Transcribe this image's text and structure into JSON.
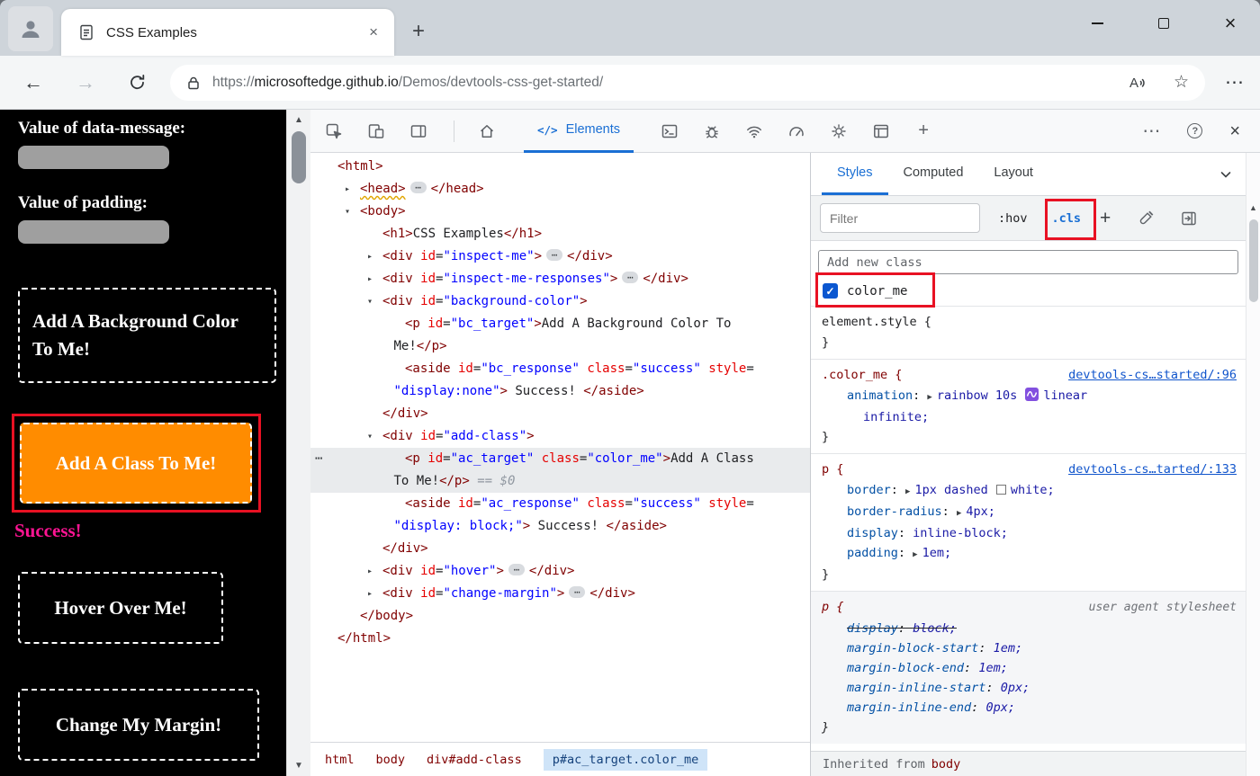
{
  "glyphs": {
    "back": "←",
    "forward": "→",
    "star": "☆",
    "more": "⋯",
    "close": "×",
    "plus": "+",
    "help": "?",
    "up": "▲",
    "down": "▼",
    "expand": "▸",
    "collapse": "▾",
    "shorthand": "▶",
    "check": "✓",
    "handle": "⋯",
    "badge": "⋯"
  },
  "colors": {
    "accent_blue": "#1a6fd4",
    "annotation_red": "#e81123",
    "class_button_bg": "#ff8c00",
    "success_text": "#ff1493"
  },
  "tab_bar": {
    "tab_title": "CSS Examples"
  },
  "address_bar": {
    "scheme": "https://",
    "host": "microsoftedge.github.io",
    "path": "/Demos/devtools-css-get-started/"
  },
  "page": {
    "data_message_label": "Value of data-message:",
    "padding_label": "Value of padding:",
    "background_button": "Add A Background Color To Me!",
    "class_button": "Add A Class To Me!",
    "success_text": "Success!",
    "hover_button": "Hover Over Me!",
    "margin_button": "Change My Margin!"
  },
  "devtools": {
    "elements_icon": "</>",
    "elements_tab": "Elements",
    "styles_tabs": [
      {
        "label": "Styles",
        "selected": true
      },
      {
        "label": "Computed",
        "selected": false
      },
      {
        "label": "Layout",
        "selected": false
      }
    ],
    "filter_placeholder": "Filter",
    "hov_label": ":hov",
    "cls_label": ".cls",
    "plus_label": "+",
    "add_class_placeholder": "Add new class",
    "class_toggle": {
      "label": "color_me",
      "checked": true
    },
    "inherited_label": "Inherited from",
    "inherited_target": "body"
  },
  "breadcrumbs": [
    {
      "label": "html",
      "selected": false
    },
    {
      "label": "body",
      "selected": false
    },
    {
      "label": "div#add-class",
      "selected": false
    },
    {
      "label": "p#ac_target.color_me",
      "selected": true
    }
  ],
  "dom_tree": {
    "lines": [
      {
        "indent": 0,
        "tokens": [
          {
            "c": "tag",
            "t": "<html>"
          }
        ]
      },
      {
        "indent": 1,
        "arrow": "right",
        "tokens": [
          {
            "c": "tagsq",
            "t": "<head>"
          },
          {
            "c": "badge"
          },
          {
            "c": "tag",
            "t": "</head>"
          }
        ]
      },
      {
        "indent": 1,
        "arrow": "down",
        "tokens": [
          {
            "c": "tag",
            "t": "<body>"
          }
        ]
      },
      {
        "indent": 2,
        "tokens": [
          {
            "c": "tag",
            "t": "<h1>"
          },
          {
            "c": "text",
            "t": "CSS Examples"
          },
          {
            "c": "tag",
            "t": "</h1>"
          }
        ]
      },
      {
        "indent": 2,
        "arrow": "right",
        "tokens": [
          {
            "c": "tag",
            "t": "<div"
          },
          {
            "c": "attr",
            "t": " id"
          },
          {
            "c": "punc",
            "t": "="
          },
          {
            "c": "val",
            "t": "\"inspect-me\""
          },
          {
            "c": "tag",
            "t": ">"
          },
          {
            "c": "badge"
          },
          {
            "c": "tag",
            "t": "</div>"
          }
        ]
      },
      {
        "indent": 2,
        "arrow": "right",
        "tokens": [
          {
            "c": "tag",
            "t": "<div"
          },
          {
            "c": "attr",
            "t": " id"
          },
          {
            "c": "punc",
            "t": "="
          },
          {
            "c": "val",
            "t": "\"inspect-me-responses\""
          },
          {
            "c": "tag",
            "t": ">"
          },
          {
            "c": "badge"
          },
          {
            "c": "tag",
            "t": "</div>"
          }
        ]
      },
      {
        "indent": 2,
        "arrow": "down",
        "tokens": [
          {
            "c": "tag",
            "t": "<div"
          },
          {
            "c": "attr",
            "t": " id"
          },
          {
            "c": "punc",
            "t": "="
          },
          {
            "c": "val",
            "t": "\"background-color\""
          },
          {
            "c": "tag",
            "t": ">"
          }
        ]
      },
      {
        "indent": 3,
        "tokens": [
          {
            "c": "tag",
            "t": "<p"
          },
          {
            "c": "attr",
            "t": " id"
          },
          {
            "c": "punc",
            "t": "="
          },
          {
            "c": "val",
            "t": "\"bc_target\""
          },
          {
            "c": "tag",
            "t": ">"
          },
          {
            "c": "text",
            "t": "Add A Background Color To"
          }
        ]
      },
      {
        "indent": 2.5,
        "tokens": [
          {
            "c": "text",
            "t": "Me!"
          },
          {
            "c": "tag",
            "t": "</p>"
          }
        ]
      },
      {
        "indent": 3,
        "tokens": [
          {
            "c": "tag",
            "t": "<aside"
          },
          {
            "c": "attr",
            "t": " id"
          },
          {
            "c": "punc",
            "t": "="
          },
          {
            "c": "val",
            "t": "\"bc_response\""
          },
          {
            "c": "attr",
            "t": " class"
          },
          {
            "c": "punc",
            "t": "="
          },
          {
            "c": "val",
            "t": "\"success\""
          },
          {
            "c": "attr",
            "t": " style"
          },
          {
            "c": "punc",
            "t": "="
          }
        ]
      },
      {
        "indent": 2.5,
        "tokens": [
          {
            "c": "val",
            "t": "\"display:none\""
          },
          {
            "c": "tag",
            "t": ">"
          },
          {
            "c": "text",
            "t": " Success! "
          },
          {
            "c": "tag",
            "t": "</aside>"
          }
        ]
      },
      {
        "indent": 2,
        "tokens": [
          {
            "c": "tag",
            "t": "</div>"
          }
        ]
      },
      {
        "indent": 2,
        "arrow": "down",
        "tokens": [
          {
            "c": "tag",
            "t": "<div"
          },
          {
            "c": "attr",
            "t": " id"
          },
          {
            "c": "punc",
            "t": "="
          },
          {
            "c": "val",
            "t": "\"add-class\""
          },
          {
            "c": "tag",
            "t": ">"
          }
        ]
      },
      {
        "indent": 3,
        "selected": true,
        "handle": true,
        "tokens": [
          {
            "c": "tag",
            "t": "<p"
          },
          {
            "c": "attr",
            "t": " id"
          },
          {
            "c": "punc",
            "t": "="
          },
          {
            "c": "val",
            "t": "\"ac_target\""
          },
          {
            "c": "attr",
            "t": " class"
          },
          {
            "c": "punc",
            "t": "="
          },
          {
            "c": "val",
            "t": "\"color_me\""
          },
          {
            "c": "tag",
            "t": ">"
          },
          {
            "c": "text",
            "t": "Add A Class"
          }
        ]
      },
      {
        "indent": 2.5,
        "selected": true,
        "tokens": [
          {
            "c": "text",
            "t": "To Me!"
          },
          {
            "c": "tag",
            "t": "</p>"
          },
          {
            "c": "meta",
            "t": " == $0"
          }
        ]
      },
      {
        "indent": 3,
        "tokens": [
          {
            "c": "tag",
            "t": "<aside"
          },
          {
            "c": "attr",
            "t": " id"
          },
          {
            "c": "punc",
            "t": "="
          },
          {
            "c": "val",
            "t": "\"ac_response\""
          },
          {
            "c": "attr",
            "t": " class"
          },
          {
            "c": "punc",
            "t": "="
          },
          {
            "c": "val",
            "t": "\"success\""
          },
          {
            "c": "attr",
            "t": " style"
          },
          {
            "c": "punc",
            "t": "="
          }
        ]
      },
      {
        "indent": 2.5,
        "tokens": [
          {
            "c": "val",
            "t": "\"display: block;\""
          },
          {
            "c": "tag",
            "t": ">"
          },
          {
            "c": "text",
            "t": " Success! "
          },
          {
            "c": "tag",
            "t": "</aside>"
          }
        ]
      },
      {
        "indent": 2,
        "tokens": [
          {
            "c": "tag",
            "t": "</div>"
          }
        ]
      },
      {
        "indent": 2,
        "arrow": "right",
        "tokens": [
          {
            "c": "tag",
            "t": "<div"
          },
          {
            "c": "attr",
            "t": " id"
          },
          {
            "c": "punc",
            "t": "="
          },
          {
            "c": "val",
            "t": "\"hover\""
          },
          {
            "c": "tag",
            "t": ">"
          },
          {
            "c": "badge"
          },
          {
            "c": "tag",
            "t": "</div>"
          }
        ]
      },
      {
        "indent": 2,
        "arrow": "right",
        "tokens": [
          {
            "c": "tag",
            "t": "<div"
          },
          {
            "c": "attr",
            "t": " id"
          },
          {
            "c": "punc",
            "t": "="
          },
          {
            "c": "val",
            "t": "\"change-margin\""
          },
          {
            "c": "tag",
            "t": ">"
          },
          {
            "c": "badge"
          },
          {
            "c": "tag",
            "t": "</div>"
          }
        ]
      },
      {
        "indent": 1,
        "tokens": [
          {
            "c": "tag",
            "t": "</body>"
          }
        ]
      },
      {
        "indent": 0,
        "tokens": [
          {
            "c": "tag",
            "t": "</html>"
          }
        ]
      }
    ]
  },
  "styles_rules": [
    {
      "selector": "element.style",
      "plain": true,
      "decls": []
    },
    {
      "selector": ".color_me",
      "link": "devtools-cs…started/:96",
      "decls": [
        {
          "name": "animation",
          "parts": [
            {
              "k": "arrow"
            },
            {
              "k": "v",
              "t": "rainbow 10s"
            },
            {
              "k": "anim"
            },
            {
              "k": "v",
              "t": "linear"
            }
          ],
          "wrap": "infinite;"
        }
      ]
    },
    {
      "selector": "p",
      "link": "devtools-cs…tarted/:133",
      "decls": [
        {
          "name": "border",
          "parts": [
            {
              "k": "arrow"
            },
            {
              "k": "v",
              "t": "1px dashed"
            },
            {
              "k": "swatch",
              "color": "#ffffff"
            },
            {
              "k": "v",
              "t": "white;"
            }
          ]
        },
        {
          "name": "border-radius",
          "parts": [
            {
              "k": "arrow"
            },
            {
              "k": "v",
              "t": "4px;"
            }
          ]
        },
        {
          "name": "display",
          "parts": [
            {
              "k": "v",
              "t": "inline-block;"
            }
          ]
        },
        {
          "name": "padding",
          "parts": [
            {
              "k": "arrow"
            },
            {
              "k": "v",
              "t": "1em;"
            }
          ]
        }
      ]
    },
    {
      "selector": "p",
      "origin": "user agent stylesheet",
      "ua": true,
      "decls": [
        {
          "name": "display",
          "parts": [
            {
              "k": "v",
              "t": "block;"
            }
          ],
          "struck": true
        },
        {
          "name": "margin-block-start",
          "parts": [
            {
              "k": "v",
              "t": "1em;"
            }
          ]
        },
        {
          "name": "margin-block-end",
          "parts": [
            {
              "k": "v",
              "t": "1em;"
            }
          ]
        },
        {
          "name": "margin-inline-start",
          "parts": [
            {
              "k": "v",
              "t": "0px;"
            }
          ]
        },
        {
          "name": "margin-inline-end",
          "parts": [
            {
              "k": "v",
              "t": "0px;"
            }
          ]
        }
      ]
    }
  ]
}
